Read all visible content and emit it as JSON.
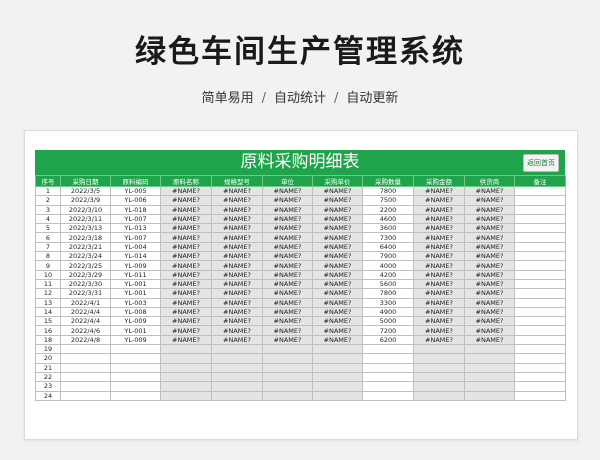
{
  "hero": {
    "title": "绿色车间生产管理系统",
    "subtitle_parts": [
      "简单易用",
      "自动统计",
      "自动更新"
    ],
    "separator": "/"
  },
  "sheet": {
    "title": "原料采购明细表",
    "home_button": "返回首页",
    "accent_color": "#1fa34b",
    "columns": [
      "序号",
      "采购日期",
      "原料编码",
      "原料名称",
      "规格型号",
      "单位",
      "采购单价",
      "采购数量",
      "采购金额",
      "供货商",
      "备注"
    ],
    "rows": [
      [
        "1",
        "2022/3/5",
        "YL-005",
        "#NAME?",
        "#NAME?",
        "#NAME?",
        "#NAME?",
        "7800",
        "#NAME?",
        "#NAME?",
        ""
      ],
      [
        "2",
        "2022/3/9",
        "YL-006",
        "#NAME?",
        "#NAME?",
        "#NAME?",
        "#NAME?",
        "7500",
        "#NAME?",
        "#NAME?",
        ""
      ],
      [
        "3",
        "2022/3/10",
        "YL-018",
        "#NAME?",
        "#NAME?",
        "#NAME?",
        "#NAME?",
        "2200",
        "#NAME?",
        "#NAME?",
        ""
      ],
      [
        "4",
        "2022/3/11",
        "YL-007",
        "#NAME?",
        "#NAME?",
        "#NAME?",
        "#NAME?",
        "4600",
        "#NAME?",
        "#NAME?",
        ""
      ],
      [
        "5",
        "2022/3/13",
        "YL-013",
        "#NAME?",
        "#NAME?",
        "#NAME?",
        "#NAME?",
        "3600",
        "#NAME?",
        "#NAME?",
        ""
      ],
      [
        "6",
        "2022/3/18",
        "YL-007",
        "#NAME?",
        "#NAME?",
        "#NAME?",
        "#NAME?",
        "7300",
        "#NAME?",
        "#NAME?",
        ""
      ],
      [
        "7",
        "2022/3/21",
        "YL-004",
        "#NAME?",
        "#NAME?",
        "#NAME?",
        "#NAME?",
        "6400",
        "#NAME?",
        "#NAME?",
        ""
      ],
      [
        "8",
        "2022/3/24",
        "YL-014",
        "#NAME?",
        "#NAME?",
        "#NAME?",
        "#NAME?",
        "7900",
        "#NAME?",
        "#NAME?",
        ""
      ],
      [
        "9",
        "2022/3/25",
        "YL-009",
        "#NAME?",
        "#NAME?",
        "#NAME?",
        "#NAME?",
        "4000",
        "#NAME?",
        "#NAME?",
        ""
      ],
      [
        "10",
        "2022/3/29",
        "YL-011",
        "#NAME?",
        "#NAME?",
        "#NAME?",
        "#NAME?",
        "4200",
        "#NAME?",
        "#NAME?",
        ""
      ],
      [
        "11",
        "2022/3/30",
        "YL-001",
        "#NAME?",
        "#NAME?",
        "#NAME?",
        "#NAME?",
        "5600",
        "#NAME?",
        "#NAME?",
        ""
      ],
      [
        "12",
        "2022/3/31",
        "YL-001",
        "#NAME?",
        "#NAME?",
        "#NAME?",
        "#NAME?",
        "7800",
        "#NAME?",
        "#NAME?",
        ""
      ],
      [
        "13",
        "2022/4/1",
        "YL-003",
        "#NAME?",
        "#NAME?",
        "#NAME?",
        "#NAME?",
        "3300",
        "#NAME?",
        "#NAME?",
        ""
      ],
      [
        "14",
        "2022/4/4",
        "YL-008",
        "#NAME?",
        "#NAME?",
        "#NAME?",
        "#NAME?",
        "4900",
        "#NAME?",
        "#NAME?",
        ""
      ],
      [
        "15",
        "2022/4/4",
        "YL-009",
        "#NAME?",
        "#NAME?",
        "#NAME?",
        "#NAME?",
        "5000",
        "#NAME?",
        "#NAME?",
        ""
      ],
      [
        "16",
        "2022/4/6",
        "YL-001",
        "#NAME?",
        "#NAME?",
        "#NAME?",
        "#NAME?",
        "7200",
        "#NAME?",
        "#NAME?",
        ""
      ],
      [
        "18",
        "2022/4/8",
        "YL-009",
        "#NAME?",
        "#NAME?",
        "#NAME?",
        "#NAME?",
        "6200",
        "#NAME?",
        "#NAME?",
        ""
      ],
      [
        "19",
        "",
        "",
        "",
        "",
        "",
        "",
        "",
        "",
        "",
        ""
      ],
      [
        "20",
        "",
        "",
        "",
        "",
        "",
        "",
        "",
        "",
        "",
        ""
      ],
      [
        "21",
        "",
        "",
        "",
        "",
        "",
        "",
        "",
        "",
        "",
        ""
      ],
      [
        "22",
        "",
        "",
        "",
        "",
        "",
        "",
        "",
        "",
        "",
        ""
      ],
      [
        "23",
        "",
        "",
        "",
        "",
        "",
        "",
        "",
        "",
        "",
        ""
      ],
      [
        "24",
        "",
        "",
        "",
        "",
        "",
        "",
        "",
        "",
        "",
        ""
      ]
    ]
  }
}
